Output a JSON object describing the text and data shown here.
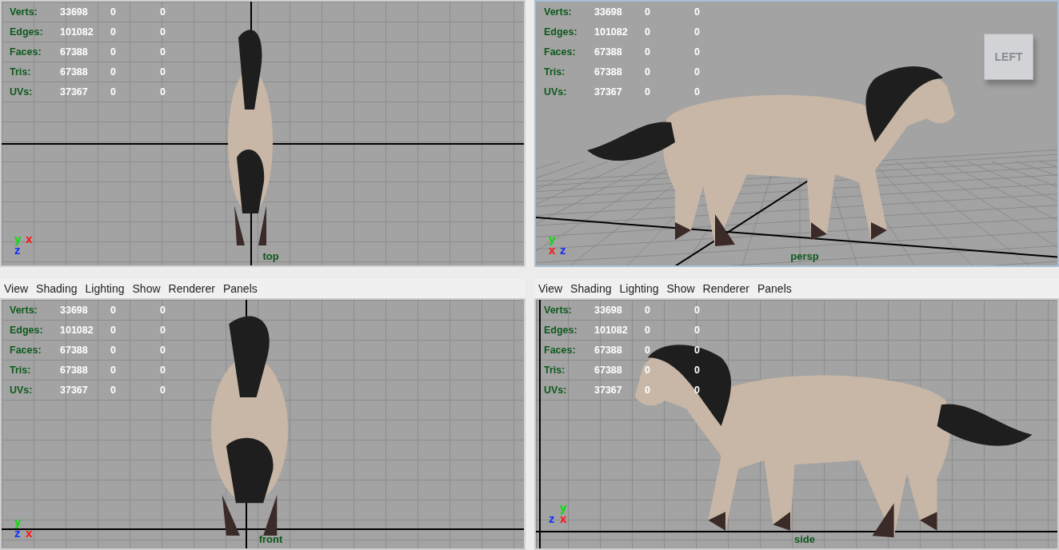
{
  "viewports": [
    {
      "camera": "top",
      "kind": "top",
      "active": false,
      "stats": [
        {
          "label": "Verts:",
          "values": [
            "33698",
            "0",
            "0"
          ]
        },
        {
          "label": "Edges:",
          "values": [
            "101082",
            "0",
            "0"
          ]
        },
        {
          "label": "Faces:",
          "values": [
            "67388",
            "0",
            "0"
          ]
        },
        {
          "label": "Tris:",
          "values": [
            "67388",
            "0",
            "0"
          ]
        },
        {
          "label": "UVs:",
          "values": [
            "37367",
            "0",
            "0"
          ]
        }
      ],
      "axes": [
        {
          "label": "y",
          "color": "#00e000"
        },
        {
          "label": "x",
          "color": "#ff1010"
        },
        {
          "label": "z",
          "color": "#1030ff"
        }
      ]
    },
    {
      "camera": "persp",
      "kind": "persp",
      "active": true,
      "view_cube": {
        "label": "LEFT"
      },
      "stats": [
        {
          "label": "Verts:",
          "values": [
            "33698",
            "0",
            "0"
          ]
        },
        {
          "label": "Edges:",
          "values": [
            "101082",
            "0",
            "0"
          ]
        },
        {
          "label": "Faces:",
          "values": [
            "67388",
            "0",
            "0"
          ]
        },
        {
          "label": "Tris:",
          "values": [
            "67388",
            "0",
            "0"
          ]
        },
        {
          "label": "UVs:",
          "values": [
            "37367",
            "0",
            "0"
          ]
        }
      ],
      "axes": [
        {
          "label": "y",
          "color": "#00e000"
        },
        {
          "label": "x",
          "color": "#ff1010"
        },
        {
          "label": "z",
          "color": "#1030ff"
        }
      ]
    },
    {
      "camera": "front",
      "kind": "front",
      "active": false,
      "menu": [
        "View",
        "Shading",
        "Lighting",
        "Show",
        "Renderer",
        "Panels"
      ],
      "stats": [
        {
          "label": "Verts:",
          "values": [
            "33698",
            "0",
            "0"
          ]
        },
        {
          "label": "Edges:",
          "values": [
            "101082",
            "0",
            "0"
          ]
        },
        {
          "label": "Faces:",
          "values": [
            "67388",
            "0",
            "0"
          ]
        },
        {
          "label": "Tris:",
          "values": [
            "67388",
            "0",
            "0"
          ]
        },
        {
          "label": "UVs:",
          "values": [
            "37367",
            "0",
            "0"
          ]
        }
      ],
      "axes": [
        {
          "label": "y",
          "color": "#00e000"
        },
        {
          "label": "z",
          "color": "#1030ff"
        },
        {
          "label": "x",
          "color": "#ff1010"
        }
      ]
    },
    {
      "camera": "side",
      "kind": "side",
      "active": false,
      "menu": [
        "View",
        "Shading",
        "Lighting",
        "Show",
        "Renderer",
        "Panels"
      ],
      "stats": [
        {
          "label": "Verts:",
          "values": [
            "33698",
            "0",
            "0"
          ]
        },
        {
          "label": "Edges:",
          "values": [
            "101082",
            "0",
            "0"
          ]
        },
        {
          "label": "Faces:",
          "values": [
            "67388",
            "0",
            "0"
          ]
        },
        {
          "label": "Tris:",
          "values": [
            "67388",
            "0",
            "0"
          ]
        },
        {
          "label": "UVs:",
          "values": [
            "37367",
            "0",
            "0"
          ]
        }
      ],
      "axes": [
        {
          "label": "y",
          "color": "#00e000"
        },
        {
          "label": "z",
          "color": "#1030ff"
        },
        {
          "label": "x",
          "color": "#ff1010"
        }
      ]
    }
  ]
}
